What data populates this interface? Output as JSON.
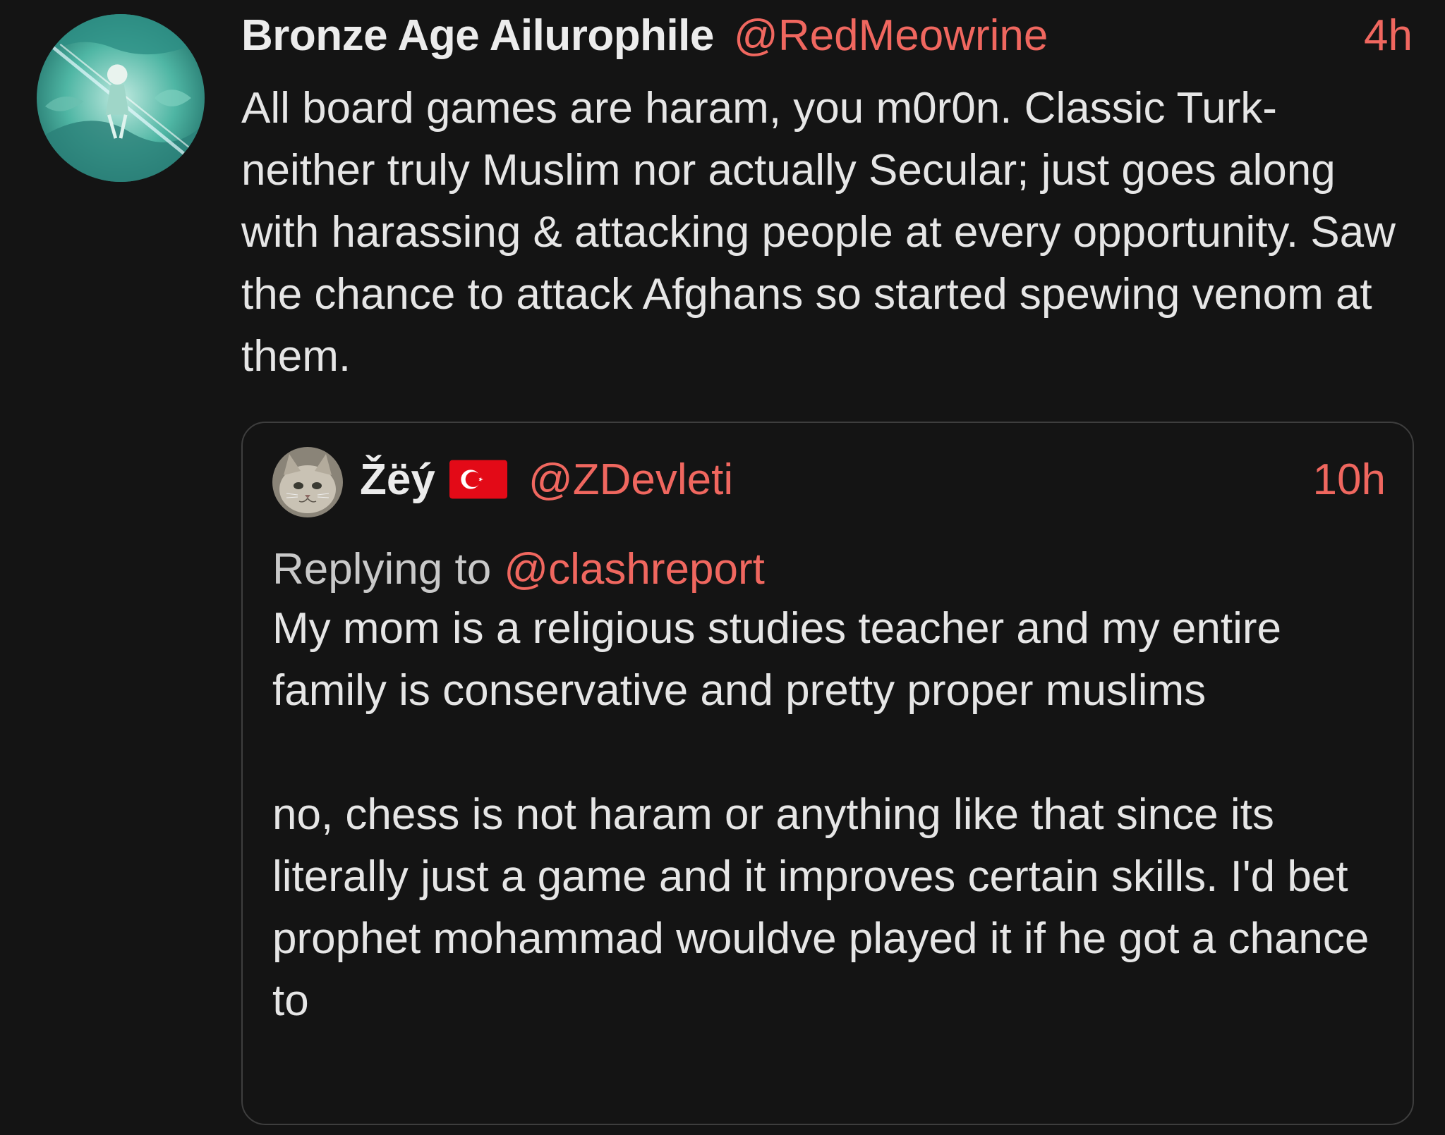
{
  "post": {
    "display_name": "Bronze Age Ailurophile",
    "handle": "@RedMeowrine",
    "time": "4h",
    "avatar_icon": "anime-character-avatar",
    "text": "All board games are haram, you m0r0n. Classic Turk- neither truly Muslim nor actually Secular; just goes along with harassing & attacking people at every opportunity. Saw the chance to attack Afghans so started spewing venom at them."
  },
  "quoted_post": {
    "display_name": "Žëý",
    "flag_icon": "turkey-flag-icon",
    "handle": "@ZDevleti",
    "time": "10h",
    "avatar_icon": "cat-avatar",
    "replying_label": "Replying to",
    "replying_to": "@clashreport",
    "paragraphs": [
      "My mom is a religious studies teacher and my entire family is conservative and pretty proper muslims",
      "no, chess is not haram or anything like that since its literally just a game and it improves certain skills. I'd bet prophet mohammad wouldve played it if he got a chance to"
    ]
  },
  "colors": {
    "background": "#141414",
    "accent": "#f0675f",
    "text": "#e6e6e6",
    "border": "#3e3e3e"
  }
}
